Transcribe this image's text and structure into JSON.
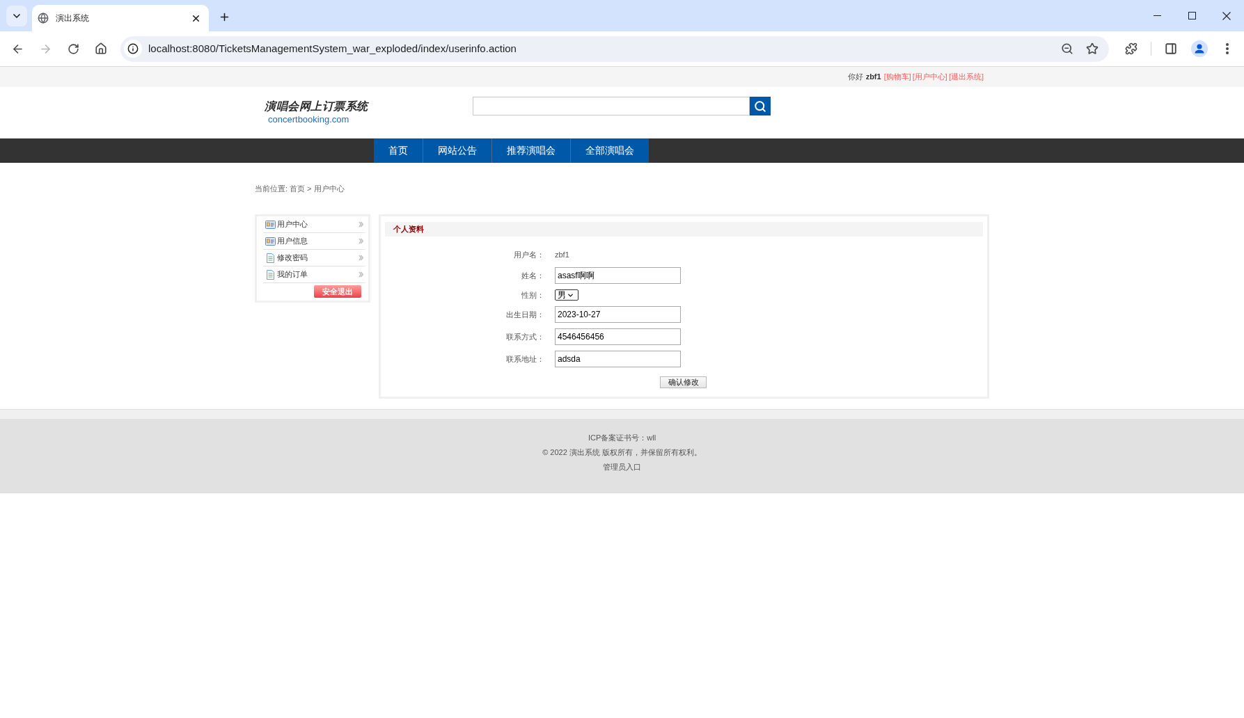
{
  "browser": {
    "tab_title": "演出系统",
    "url": "localhost:8080/TicketsManagementSystem_war_exploded/index/userinfo.action",
    "can_go_forward": false
  },
  "top_bar": {
    "greeting": "你好",
    "username": "zbf1",
    "links": [
      "[购物车]",
      "[用户中心]",
      "[退出系统]"
    ]
  },
  "header": {
    "logo_title": "演唱会网上订票系统",
    "logo_domain": "concertbooking.com"
  },
  "nav": [
    "首页",
    "网站公告",
    "推荐演唱会",
    "全部演唱会"
  ],
  "breadcrumb": {
    "label": "当前位置:",
    "items": [
      "首页",
      "用户中心"
    ],
    "separator": ">"
  },
  "sidebar": {
    "items": [
      {
        "label": "用户中心",
        "kind": "profile"
      },
      {
        "label": "用户信息",
        "kind": "profile"
      },
      {
        "label": "修改密码",
        "kind": "page"
      },
      {
        "label": "我的订单",
        "kind": "page"
      }
    ],
    "logout": "安全退出"
  },
  "profile_panel": {
    "title": "个人资料",
    "fields": [
      {
        "label": "用户名：",
        "kind": "text",
        "value": "zbf1"
      },
      {
        "label": "姓名：",
        "kind": "input",
        "value": "asasf啊啊"
      },
      {
        "label": "性别：",
        "kind": "select",
        "value": "男"
      },
      {
        "label": "出生日期：",
        "kind": "input",
        "value": "2023-10-27"
      },
      {
        "label": "联系方式：",
        "kind": "input",
        "value": "4546456456"
      },
      {
        "label": "联系地址：",
        "kind": "input",
        "value": "adsda"
      }
    ],
    "submit": "确认修改"
  },
  "footer": {
    "icp": "ICP备案证书号：wll",
    "copyright": "© 2022 演出系统 版权所有，并保留所有权利。",
    "admin_link": "管理员入口"
  }
}
